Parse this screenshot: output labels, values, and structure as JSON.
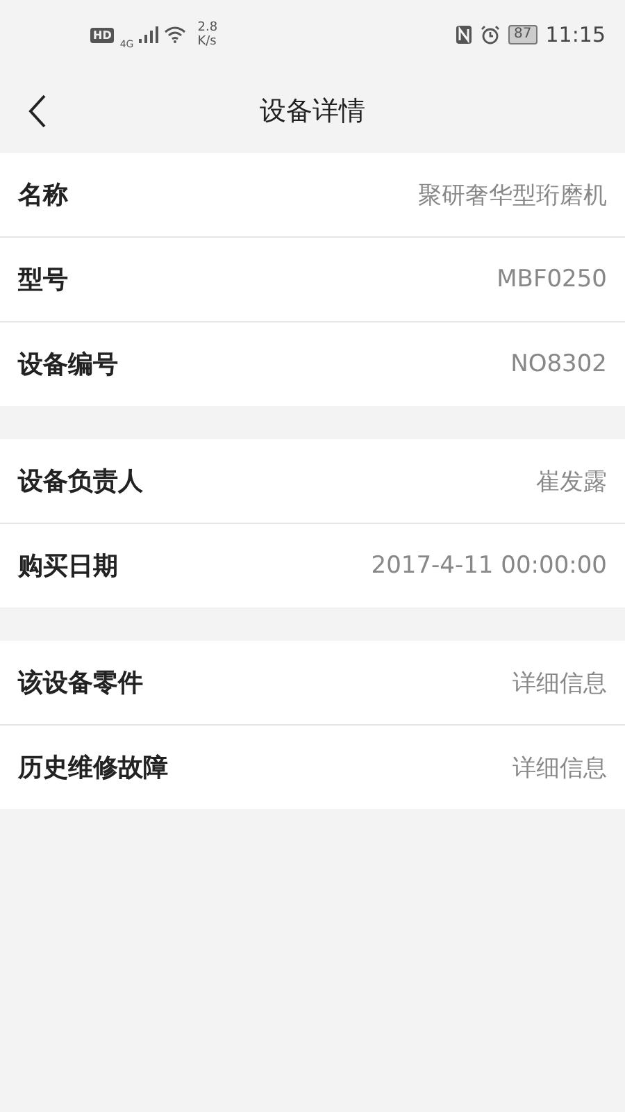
{
  "status_bar": {
    "hd": "HD",
    "network": "4G",
    "speed_value": "2.8",
    "speed_unit": "K/s",
    "battery": "87",
    "time": "11:15"
  },
  "header": {
    "title": "设备详情"
  },
  "groups": [
    {
      "rows": [
        {
          "label": "名称",
          "value": "聚研奢华型珩磨机"
        },
        {
          "label": "型号",
          "value": "MBF0250"
        },
        {
          "label": "设备编号",
          "value": "NO8302"
        }
      ]
    },
    {
      "rows": [
        {
          "label": "设备负责人",
          "value": "崔发露"
        },
        {
          "label": "购买日期",
          "value": "2017-4-11 00:00:00"
        }
      ]
    },
    {
      "rows": [
        {
          "label": "该设备零件",
          "value": "详细信息"
        },
        {
          "label": "历史维修故障",
          "value": "详细信息"
        }
      ]
    }
  ]
}
